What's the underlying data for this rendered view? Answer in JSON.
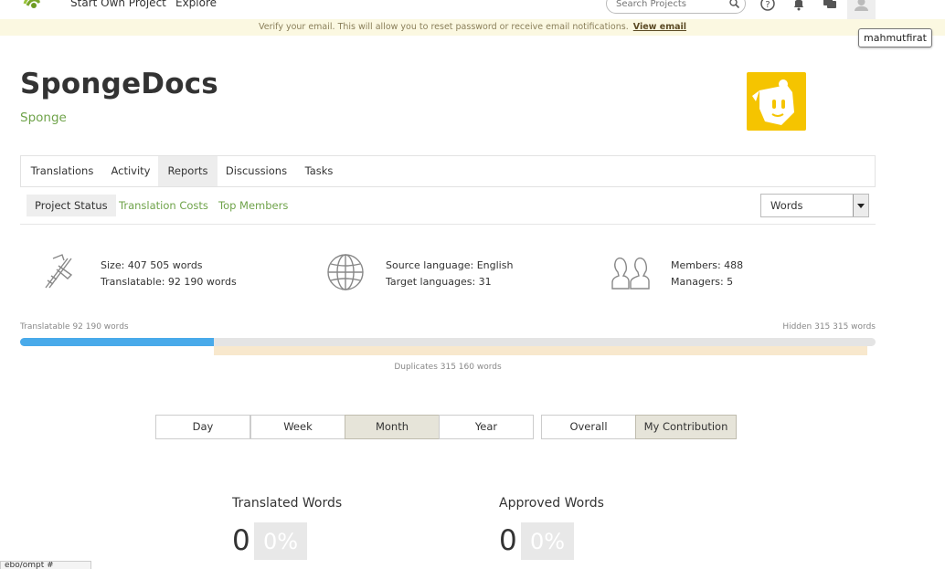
{
  "topnav": {
    "start_project": "Start Own Project",
    "explore": "Explore",
    "search_placeholder": "Search Projects",
    "icons": [
      "help-icon",
      "bell-icon",
      "messages-icon",
      "user-avatar-icon"
    ]
  },
  "notice": {
    "text": "Verify your email. This will allow you to reset password or receive email notifications.",
    "link": "View email"
  },
  "user_tooltip": "mahmutfirat",
  "project": {
    "title": "SpongeDocs",
    "owner": "Sponge",
    "logo_color": "#f5c400"
  },
  "tabs": [
    {
      "label": "Translations"
    },
    {
      "label": "Activity"
    },
    {
      "label": "Reports",
      "active": true
    },
    {
      "label": "Discussions"
    },
    {
      "label": "Tasks"
    }
  ],
  "subtabs": [
    {
      "label": "Project Status",
      "active": true
    },
    {
      "label": "Translation Costs"
    },
    {
      "label": "Top Members"
    }
  ],
  "unit_select": "Words",
  "stats": {
    "size": "Size: 407 505 words",
    "translatable": "Translatable: 92 190 words",
    "source_language": "Source language: English",
    "target_languages": "Target languages: 31",
    "members": "Members: 488",
    "managers": "Managers: 5"
  },
  "progress": {
    "translatable_label": "Translatable 92 190 words",
    "hidden_label": "Hidden 315 315 words",
    "duplicates_label": "Duplicates 315 160 words",
    "translatable_fraction": 0.2262,
    "duplicates_fraction": 0.7734,
    "colors": {
      "translatable": "#49aaea",
      "track": "#e4e4e4",
      "duplicates": "#f8e8cd"
    }
  },
  "periods": [
    {
      "label": "Day"
    },
    {
      "label": "Week"
    },
    {
      "label": "Month",
      "active": true
    },
    {
      "label": "Year"
    }
  ],
  "scope": [
    {
      "label": "Overall"
    },
    {
      "label": "My Contribution",
      "active": true
    }
  ],
  "metrics": [
    {
      "label": "Translated Words",
      "value": "0",
      "percent": "0%"
    },
    {
      "label": "Approved Words",
      "value": "0",
      "percent": "0%"
    }
  ],
  "statusbar": "ebo/ompt #"
}
